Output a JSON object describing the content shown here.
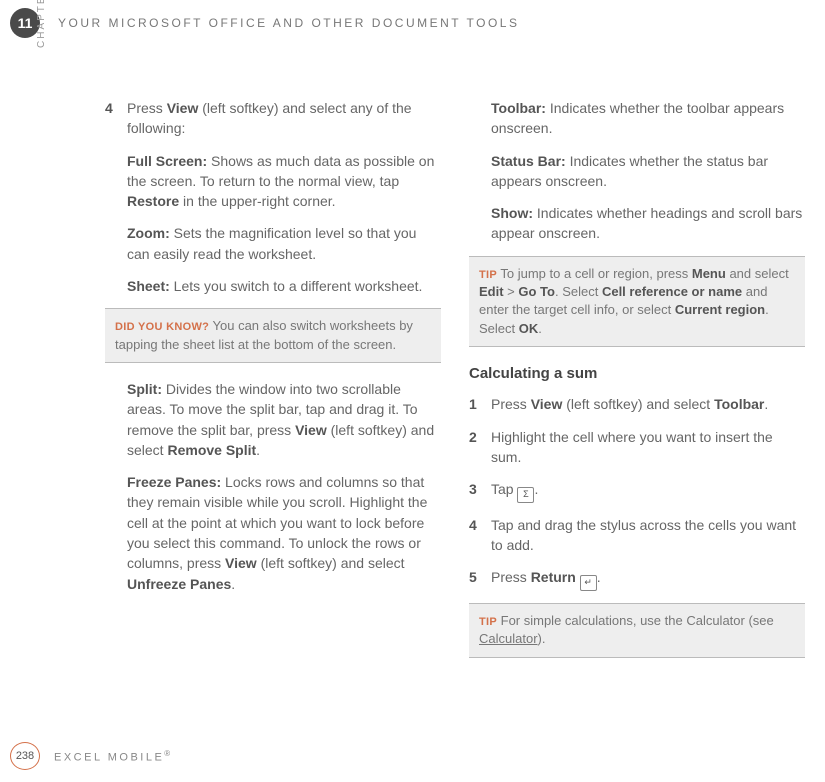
{
  "header": {
    "chapter_number": "11",
    "title": "YOUR MICROSOFT OFFICE AND OTHER DOCUMENT TOOLS",
    "chapter_label": "CHAPTER"
  },
  "left": {
    "step4_num": "4",
    "step4_a": "Press ",
    "step4_b": "View",
    "step4_c": " (left softkey) and select any of the following:",
    "fullscreen_label": "Full Screen:",
    "fullscreen_a": " Shows as much data as possible on the screen. To return to the normal view, tap ",
    "fullscreen_b": "Restore",
    "fullscreen_c": " in the upper-right corner.",
    "zoom_label": "Zoom:",
    "zoom_text": " Sets the magnification level so that you can easily read the worksheet.",
    "sheet_label": "Sheet:",
    "sheet_text": " Lets you switch to a different worksheet.",
    "dyk_label": "DID YOU KNOW?",
    "dyk_text": "  You can also switch worksheets by tapping the sheet list at the bottom of the screen.",
    "split_label": "Split:",
    "split_a": " Divides the window into two scrollable areas. To move the split bar, tap and drag it. To remove the split bar, press ",
    "split_b": "View",
    "split_c": " (left softkey) and select ",
    "split_d": "Remove Split",
    "split_e": ".",
    "freeze_label": "Freeze Panes:",
    "freeze_a": " Locks rows and columns so that they remain visible while you scroll. Highlight the cell at the point at which you want to lock before you select this command. To unlock the rows or columns, press ",
    "freeze_b": "View",
    "freeze_c": " (left softkey) and select ",
    "freeze_d": "Unfreeze Panes",
    "freeze_e": "."
  },
  "right": {
    "toolbar_label": "Toolbar:",
    "toolbar_text": " Indicates whether the toolbar appears onscreen.",
    "status_label": "Status Bar:",
    "status_text": " Indicates whether the status bar appears onscreen.",
    "show_label": "Show:",
    "show_text": " Indicates whether headings and scroll bars appear onscreen.",
    "tip1_label": "TIP",
    "tip1_a": "  To jump to a cell or region, press ",
    "tip1_b": "Menu",
    "tip1_c": " and select ",
    "tip1_d": "Edit",
    "tip1_e": " > ",
    "tip1_f": "Go To",
    "tip1_g": ". Select ",
    "tip1_h": "Cell reference or name",
    "tip1_i": " and enter the target cell info, or select ",
    "tip1_j": "Current region",
    "tip1_k": ". Select ",
    "tip1_l": "OK",
    "tip1_m": ".",
    "calc_heading": "Calculating a sum",
    "s1_num": "1",
    "s1_a": "Press ",
    "s1_b": "View",
    "s1_c": " (left softkey) and select ",
    "s1_d": "Toolbar",
    "s1_e": ".",
    "s2_num": "2",
    "s2_text": "Highlight the cell where you want to insert the sum.",
    "s3_num": "3",
    "s3_a": "Tap ",
    "s3_b": ".",
    "s4_num": "4",
    "s4_text": "Tap and drag the stylus across the cells you want to add.",
    "s5_num": "5",
    "s5_a": "Press ",
    "s5_b": "Return",
    "s5_c": " ",
    "s5_d": ".",
    "tip2_label": "TIP",
    "tip2_a": "  For simple calculations, use the Calculator (see ",
    "tip2_b": "Calculator",
    "tip2_c": ").",
    "icon_sum": "Σ",
    "icon_return": "↵"
  },
  "footer": {
    "page": "238",
    "title": "EXCEL MOBILE",
    "reg": "®"
  }
}
